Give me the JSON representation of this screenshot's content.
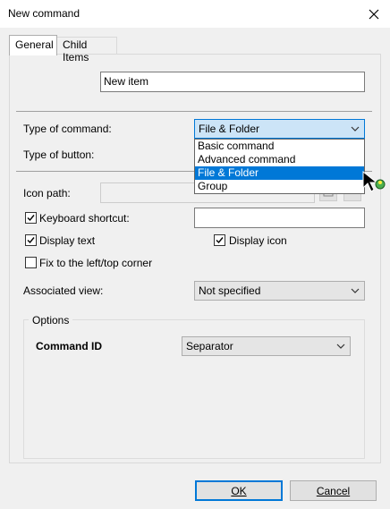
{
  "window": {
    "title": "New command"
  },
  "tabs": [
    {
      "label": "General",
      "active": true
    },
    {
      "label": "Child Items",
      "active": false
    }
  ],
  "name_field": {
    "value": "New item"
  },
  "type_of_command": {
    "label": "Type of command:",
    "selected": "File & Folder",
    "options": [
      "Basic command",
      "Advanced command",
      "File & Folder",
      "Group"
    ]
  },
  "type_of_button": {
    "label": "Type of button:"
  },
  "icon_path": {
    "label": "Icon path:",
    "value": "",
    "browse_label": "..."
  },
  "keyboard_shortcut": {
    "label": "Keyboard shortcut:",
    "checked": true,
    "value": ""
  },
  "display_text": {
    "label": "Display text",
    "checked": true
  },
  "display_icon": {
    "label": "Display icon",
    "checked": true
  },
  "fix_corner": {
    "label": "Fix to the left/top corner",
    "checked": false
  },
  "associated_view": {
    "label": "Associated view:",
    "selected": "Not specified"
  },
  "options_group": {
    "title": "Options",
    "command_id_label": "Command ID",
    "command_id_value": "Separator"
  },
  "buttons": {
    "ok": "OK",
    "cancel": "Cancel"
  },
  "colors": {
    "accent": "#0078d7",
    "window_bg": "#f0f0f0",
    "selection": "#0078d7"
  }
}
